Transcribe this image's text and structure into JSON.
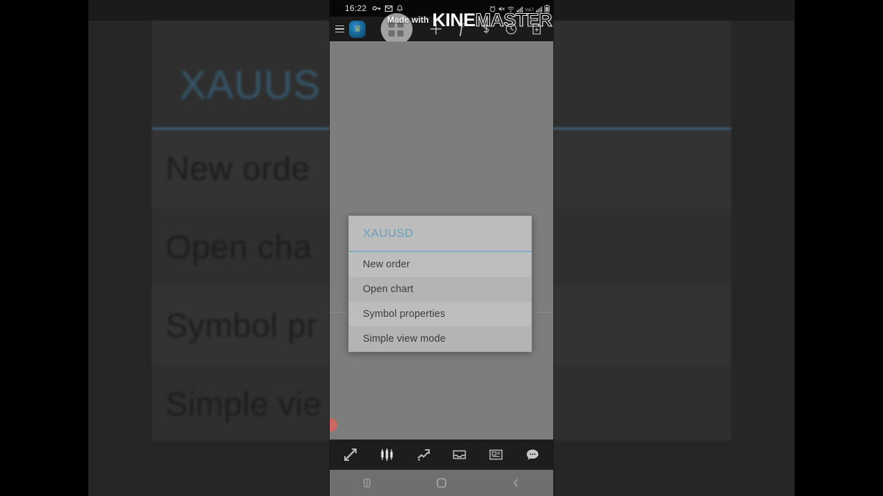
{
  "watermark": {
    "made_with": "Made with",
    "brand_bold": "KINE",
    "brand_outline": "MASTER"
  },
  "status_bar": {
    "time": "16:22",
    "left_icons": [
      "key-icon",
      "mail-icon",
      "bell-icon"
    ],
    "right_icons": [
      "alarm-icon",
      "mute-icon",
      "wifi-icon",
      "signal-icon",
      "volte-icon",
      "signal2-icon",
      "battery-icon"
    ]
  },
  "toolbar": {
    "menu_icon": "hamburger-icon",
    "app_logo": "mt4-app-logo",
    "grid_icon": "grid-view-icon",
    "grid_selected": true,
    "actions": [
      {
        "name": "add-symbol-icon",
        "label": "+"
      },
      {
        "name": "function-f-icon",
        "label": "f"
      },
      {
        "name": "currency-settings-icon",
        "label": ""
      },
      {
        "name": "clock-icon",
        "label": ""
      },
      {
        "name": "new-document-icon",
        "label": ""
      }
    ]
  },
  "popup": {
    "title": "XAUUSD",
    "items": [
      {
        "label": "New order"
      },
      {
        "label": "Open chart"
      },
      {
        "label": "Symbol properties"
      },
      {
        "label": "Simple view mode"
      }
    ]
  },
  "bottom_nav": [
    {
      "name": "quotes-icon",
      "label": "Quotes"
    },
    {
      "name": "charts-candlestick-icon",
      "label": "Charts"
    },
    {
      "name": "trade-line-icon",
      "label": "Trade"
    },
    {
      "name": "mailbox-icon",
      "label": "Mailbox"
    },
    {
      "name": "news-icon",
      "label": "News"
    },
    {
      "name": "chat-icon",
      "label": "Chat"
    }
  ],
  "android_nav": [
    {
      "name": "recents-button",
      "label": "Recents"
    },
    {
      "name": "home-button",
      "label": "Home"
    },
    {
      "name": "back-button",
      "label": "Back"
    }
  ],
  "backdrop": {
    "title": "XAUUS",
    "items": [
      "New orde",
      "Open cha",
      "Symbol pr",
      "Simple vie"
    ]
  },
  "colors": {
    "accent_blue": "#7eaac4",
    "title_blue": "#6b9fbd",
    "popup_bg": "#bdbdbd",
    "popup_alt": "#b4b4b4",
    "toolbar_bg": "#1b1b1b",
    "scrim_gray": "#7d7d7d",
    "status_black": "#070707",
    "red_marker": "#cc6a62"
  }
}
